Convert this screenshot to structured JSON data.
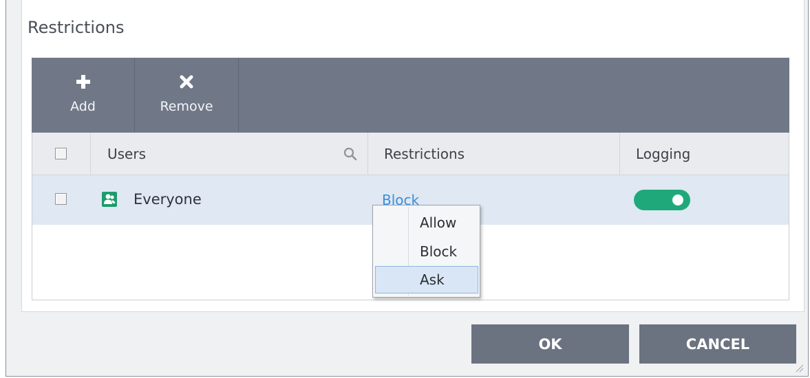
{
  "section": {
    "title": "Restrictions"
  },
  "toolbar": {
    "add": {
      "label": "Add",
      "icon": "plus-icon"
    },
    "remove": {
      "label": "Remove",
      "icon": "x-icon"
    }
  },
  "table": {
    "columns": {
      "users": "Users",
      "restrictions": "Restrictions",
      "logging": "Logging"
    },
    "rows": [
      {
        "user": "Everyone",
        "icon": "user-group-icon",
        "restriction": "Block",
        "logging": true
      }
    ]
  },
  "context_menu": {
    "items": [
      "Allow",
      "Block",
      "Ask"
    ],
    "highlighted": "Ask"
  },
  "buttons": {
    "ok": "OK",
    "cancel": "CANCEL"
  },
  "colors": {
    "toolbar": "#707888",
    "selected_row": "#dfe8f3",
    "toggle_on": "#1fa97a",
    "link": "#3a8fd8",
    "button": "#6b7280"
  }
}
